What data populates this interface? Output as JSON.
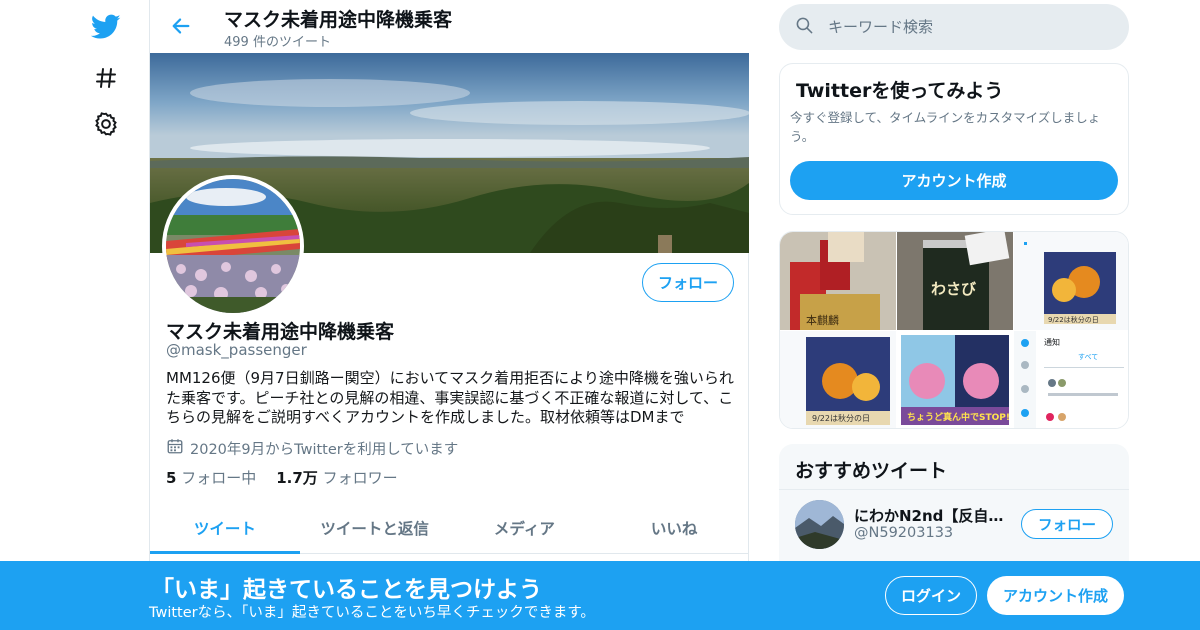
{
  "nav": {
    "icons": [
      "twitter-bird-icon",
      "hashtag-icon",
      "gear-icon"
    ]
  },
  "header": {
    "title": "マスク未着用途中降機乗客",
    "tweet_count": "499 件のツイート"
  },
  "profile": {
    "name": "マスク未着用途中降機乗客",
    "handle": "@mask_passenger",
    "bio": "MM126便（9月7日釧路ー関空）においてマスク着用拒否により途中降機を強いられた乗客です。ピーチ社との見解の相違、事実誤認に基づく不正確な報道に対して、こちらの見解をご説明すべくアカウントを作成しました。取材依頼等はDMまで",
    "joined": "2020年9月からTwitterを利用しています",
    "following_count": "5",
    "following_label": "フォロー中",
    "followers_count": "1.7万",
    "followers_label": "フォロワー",
    "follow_button": "フォロー"
  },
  "tabs": [
    {
      "label": "ツイート",
      "active": true
    },
    {
      "label": "ツイートと返信",
      "active": false
    },
    {
      "label": "メディア",
      "active": false
    },
    {
      "label": "いいね",
      "active": false
    }
  ],
  "search": {
    "placeholder": "キーワード検索"
  },
  "signup_card": {
    "title": "Twitterを使ってみよう",
    "description": "今すぐ登録して、タイムラインをカスタマイズしましょう。",
    "button": "アカウント作成"
  },
  "media_grid": {
    "cells": [
      {
        "text": "本麒麟"
      },
      {
        "text": "わさび"
      },
      {
        "text": "9/22は秋分の日"
      },
      {
        "text": "9/22は秋分の日"
      },
      {
        "text": "ちょうど真ん中でSTOP!"
      },
      {
        "text": "通知",
        "text2": "すべて"
      }
    ]
  },
  "recommended": {
    "title": "おすすめツイート",
    "user": {
      "name": "にわかN2nd【反自粛】",
      "handle": "@N59203133",
      "follow_button": "フォロー"
    }
  },
  "bottom_bar": {
    "title": "「いま」起きていることを見つけよう",
    "subtitle": "Twitterなら、「いま」起きていることをいち早くチェックできます。",
    "login": "ログイン",
    "signup": "アカウント作成"
  },
  "colors": {
    "accent": "#1da1f2",
    "text": "#0f1419",
    "secondary": "#657786",
    "border": "#e1e8ed"
  }
}
